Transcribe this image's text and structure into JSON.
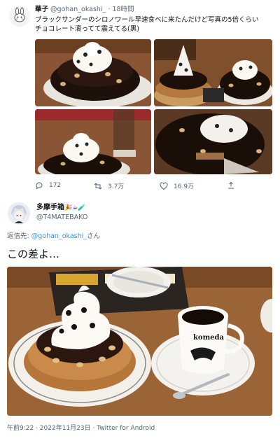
{
  "tweet1": {
    "display_name": "華子",
    "handle": "@gohan_okashi_",
    "separator": "·",
    "time": "18時間",
    "text_line1": "ブラックサンダーのシロノワール早速食べに来たんだけど写真の5倍くらい",
    "text_line2": "チョコレート滴ってて震えてる(黒)",
    "replies": "172",
    "retweets": "3.7万",
    "likes": "16.9万"
  },
  "tweet2": {
    "display_name": "多摩手箱",
    "name_emoji": "🎉☕🧪",
    "handle": "@T4MATEBAKO",
    "reply_prefix": "返信先: ",
    "reply_handle": "@gohan_okashi_",
    "reply_suffix": "さん",
    "text": "この差よ…",
    "meta": "午前9:22 · 2022年11月23日 · Twitter for Android"
  },
  "photo_text": {
    "cup_brand": "komeda"
  },
  "colors": {
    "link": "#1d9bf0",
    "muted": "#536471"
  }
}
